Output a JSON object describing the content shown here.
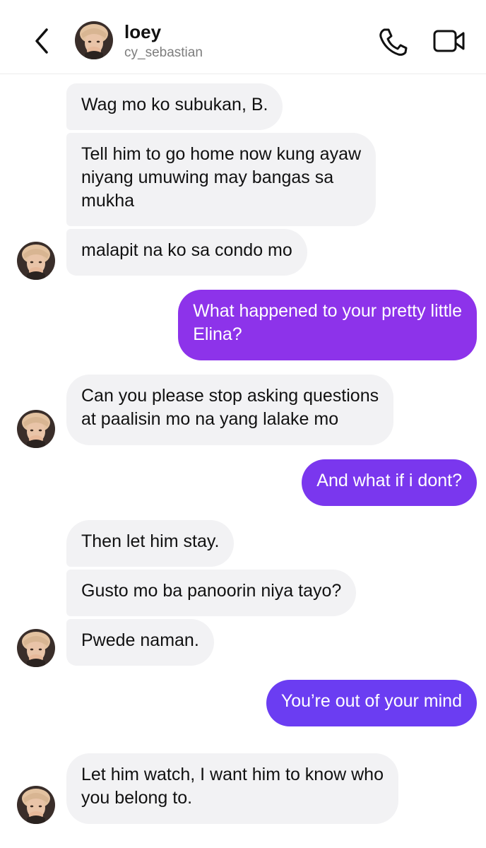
{
  "header": {
    "name": "loey",
    "username": "cy_sebastian"
  },
  "icons": {
    "back": "chevron-left-icon",
    "phone": "phone-icon",
    "video": "video-camera-icon",
    "avatar": "contact-avatar"
  },
  "colors": {
    "incoming_bubble": "#f2f2f4",
    "outgoing_purple": "#8d33ea",
    "outgoing_violet": "#6b3df2"
  },
  "messages": [
    {
      "sender": "contact",
      "lines": [
        "Wag mo ko subukan, B."
      ]
    },
    {
      "sender": "contact",
      "lines": [
        "Tell him to go home now kung ayaw",
        "niyang umuwing may bangas sa",
        "mukha"
      ]
    },
    {
      "sender": "contact",
      "lines": [
        "malapit na ko sa condo mo"
      ]
    },
    {
      "sender": "me",
      "lines": [
        "What happened to your pretty little",
        "Elina?"
      ]
    },
    {
      "sender": "contact",
      "lines": [
        "Can you please stop asking questions",
        "at paalisin mo na yang lalake mo"
      ]
    },
    {
      "sender": "me",
      "lines": [
        "And what if i dont?"
      ]
    },
    {
      "sender": "contact",
      "lines": [
        "Then let him stay."
      ]
    },
    {
      "sender": "contact",
      "lines": [
        "Gusto mo ba panoorin niya tayo?"
      ]
    },
    {
      "sender": "contact",
      "lines": [
        "Pwede naman."
      ]
    },
    {
      "sender": "me",
      "lines": [
        "You’re out of your mind"
      ]
    },
    {
      "sender": "contact",
      "lines": [
        "Let him watch, I want him to know who",
        "you belong to."
      ]
    }
  ]
}
